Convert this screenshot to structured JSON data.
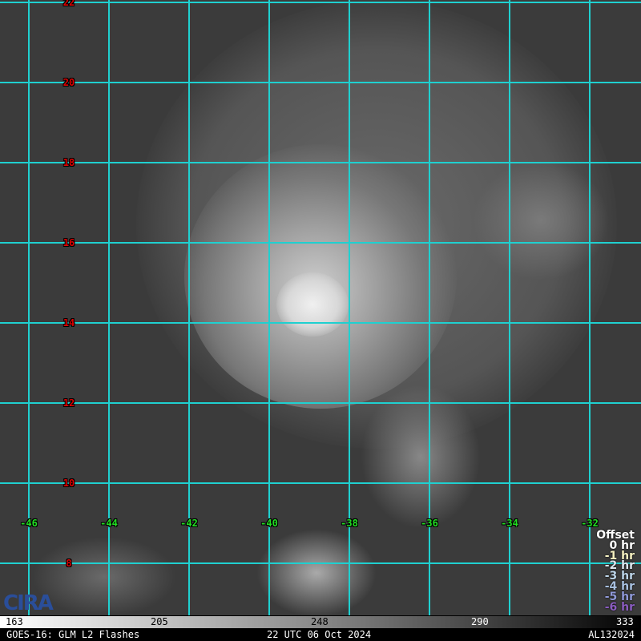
{
  "latitudes": [
    "22",
    "20",
    "18",
    "16",
    "14",
    "12",
    "10",
    "8"
  ],
  "longitudes": [
    "-46",
    "-44",
    "-42",
    "-40",
    "-38",
    "-36",
    "-34",
    "-32"
  ],
  "legend": {
    "title": "Offset",
    "items": [
      {
        "label": "0 hr",
        "color": "#ffffff"
      },
      {
        "label": "-1 hr",
        "color": "#f5f0c0"
      },
      {
        "label": "-2 hr",
        "color": "#dde6ee"
      },
      {
        "label": "-3 hr",
        "color": "#bcd4e8"
      },
      {
        "label": "-4 hr",
        "color": "#a8c0e0"
      },
      {
        "label": "-5 hr",
        "color": "#8f98d8"
      },
      {
        "label": "-6 hr",
        "color": "#8a5cc0"
      }
    ]
  },
  "colorbar": {
    "ticks": [
      "163",
      "205",
      "248",
      "290",
      "333"
    ]
  },
  "footer": {
    "left": "GOES-16: GLM L2 Flashes",
    "center": "22 UTC 06 Oct 2024",
    "right": "AL132024"
  },
  "logo": "CIRA"
}
